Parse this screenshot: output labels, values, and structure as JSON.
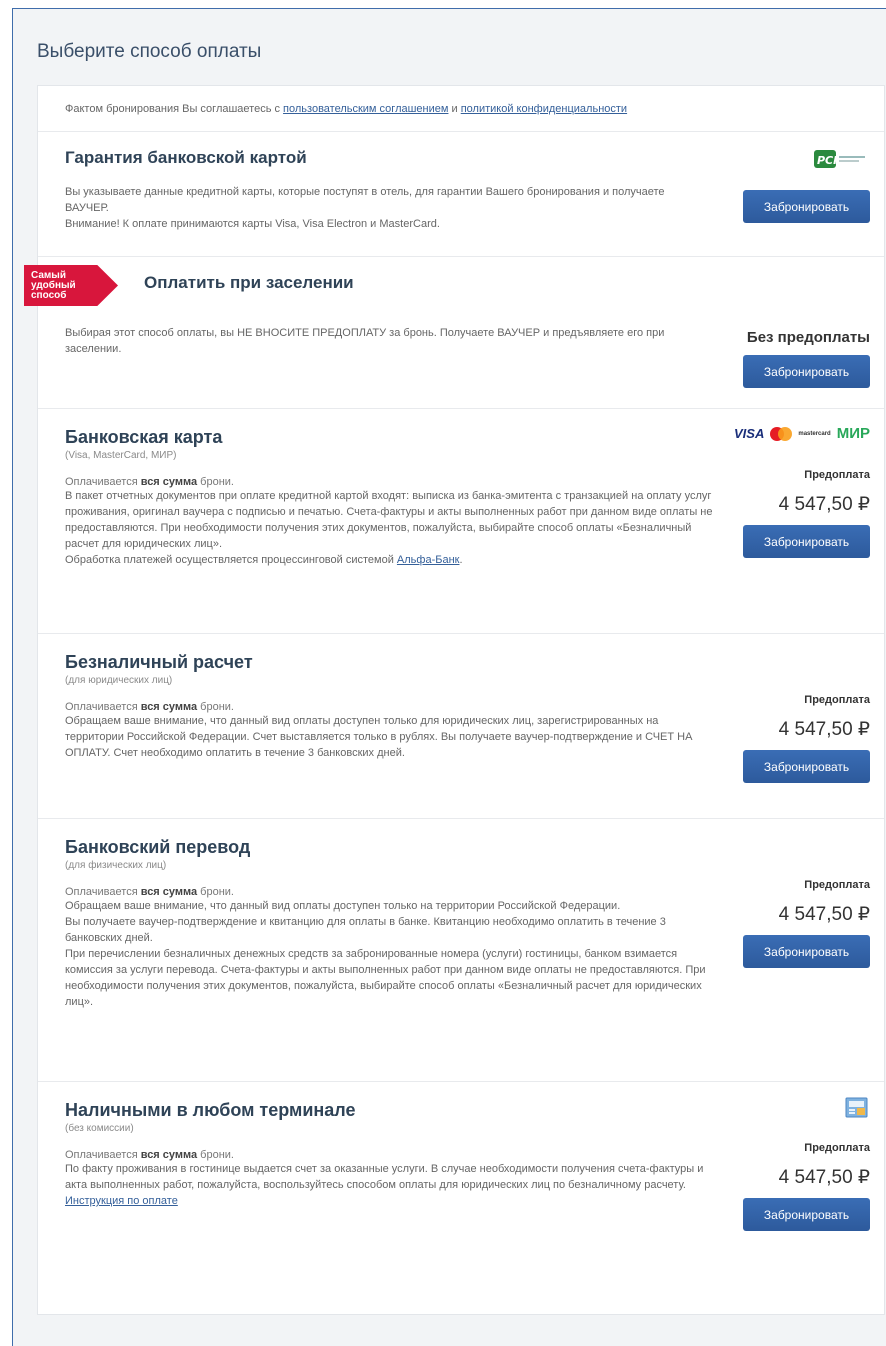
{
  "page_title": "Выберите способ оплаты",
  "agreement": {
    "prefix": "Фактом бронирования Вы соглашаетесь с ",
    "link1": "пользовательским соглашением",
    "middle": " и ",
    "link2": "политикой конфиденциальности"
  },
  "book_label": "Забронировать",
  "pays_prefix": "Оплачивается ",
  "pays_bold": "вся сумма",
  "pays_suffix": " брони.",
  "prepay_label": "Предоплата",
  "price": "4 547,50 ₽",
  "guarantee": {
    "title": "Гарантия банковской картой",
    "text1": "Вы указываете данные кредитной карты, которые поступят в отель, для гарантии Вашего бронирования и получаете ВАУЧЕР.",
    "text2": "Внимание! К оплате принимаются карты Visa, Visa Electron и MasterCard.",
    "icon": "pci-dss-logo"
  },
  "checkin": {
    "badge": [
      "Самый",
      "удобный",
      "способ"
    ],
    "title": "Оплатить при заселении",
    "text": "Выбирая этот способ оплаты, вы НЕ ВНОСИТЕ ПРЕДОПЛАТУ за бронь. Получаете ВАУЧЕР и предъявляете его при заселении.",
    "right_label": "Без предоплаты"
  },
  "bank_card": {
    "title": "Банковская карта",
    "subtitle": "(Visa, MasterCard, МИР)",
    "text": "В пакет отчетных документов при оплате кредитной картой входят: выписка из банка-эмитента с транзакцией на оплату услуг проживания, оригинал ваучера с подписью и печатью. Счета-фактуры и акты выполненных работ при данном виде оплаты не предоставляются. При необходимости получения этих документов, пожалуйста, выбирайте способ оплаты «Безналичный расчет для юридических лиц».",
    "processing_prefix": "Обработка платежей осуществляется процессинговой системой ",
    "processing_link": "Альфа-Банк",
    "processing_suffix": ".",
    "logos": {
      "visa": "VISA",
      "mastercard": "mastercard",
      "mir": "МИР"
    },
    "colors": {
      "visa": "#1a2e7a",
      "mc_red": "#e61c24",
      "mc_yellow": "#f99f1b",
      "mir": "#29a85a"
    }
  },
  "cashless": {
    "title": "Безналичный расчет",
    "subtitle": "(для юридических лиц)",
    "text": "Обращаем ваше внимание, что данный вид оплаты доступен только для юридических лиц, зарегистрированных на территории Российской Федерации. Счет выставляется только в рублях. Вы получаете ваучер-подтверждение и СЧЕТ НА ОПЛАТУ. Счет необходимо оплатить в течение 3 банковских дней."
  },
  "transfer": {
    "title": "Банковский перевод",
    "subtitle": "(для физических лиц)",
    "text1": "Обращаем ваше внимание, что данный вид оплаты доступен только на территории Российской Федерации.",
    "text2": "Вы получаете ваучер-подтверждение и квитанцию для оплаты в банке. Квитанцию необходимо оплатить в течение 3 банковских дней.",
    "text3": "При перечислении безналичных денежных средств за забронированные номера (услуги) гостиницы, банком взимается комиссия за услуги перевода. Счета-фактуры и акты выполненных работ при данном виде оплаты не предоставляются. При необходимости получения этих документов, пожалуйста, выбирайте способ оплаты «Безналичный расчет для юридических лиц»."
  },
  "terminal": {
    "title": "Наличными в любом терминале",
    "subtitle": "(без комиссии)",
    "text": "По факту проживания в гостинице выдается счет за оказанные услуги. В случае необходимости получения счета-фактуры и акта выполненных работ, пожалуйста, воспользуйтесь способом оплаты для юридических лиц по безналичному расчету.",
    "link": "Инструкция по оплате",
    "icon": "payment-terminal-icon"
  },
  "colors": {
    "accent": "#2d5a9c",
    "badge": "#d8163c",
    "title": "#2f4357"
  }
}
